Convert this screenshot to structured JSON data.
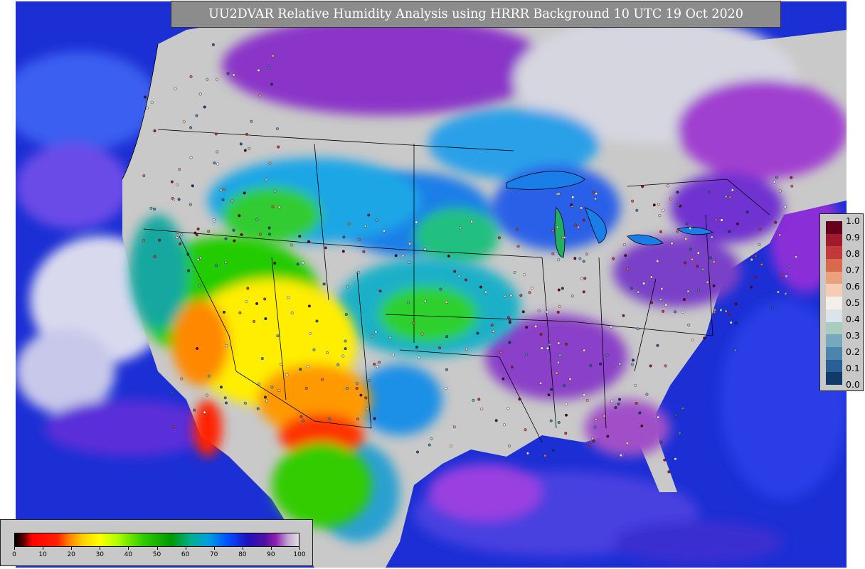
{
  "title": "UU2DVAR Relative Humidity Analysis using HRRR Background 10 UTC 19 Oct 2020",
  "station_legend": {
    "ticks": [
      "1.0",
      "0.9",
      "0.8",
      "0.7",
      "0.6",
      "0.5",
      "0.4",
      "0.3",
      "0.2",
      "0.1",
      "0.0"
    ],
    "colors": [
      "#67001f",
      "#9e1a2c",
      "#c3383b",
      "#d8694d",
      "#eba17f",
      "#f6cdb4",
      "#f5efec",
      "#dce4ea",
      "#a8cdc0",
      "#77a9bd",
      "#4b85ae",
      "#2a5f95",
      "#0f3a6a"
    ]
  },
  "rh_colorbar": {
    "ticks": [
      "0",
      "10",
      "20",
      "30",
      "40",
      "50",
      "60",
      "70",
      "80",
      "90",
      "100"
    ]
  },
  "colors": {
    "ocean": "#1a2fd0",
    "land_moist": "#c9c9c9",
    "dry_red": "#ff1a00",
    "dry_orange": "#ff9900",
    "dry_yellow": "#ffee00",
    "mid_green": "#22cc00",
    "cyan": "#1aa6e6",
    "purple": "#7a1fb3"
  }
}
